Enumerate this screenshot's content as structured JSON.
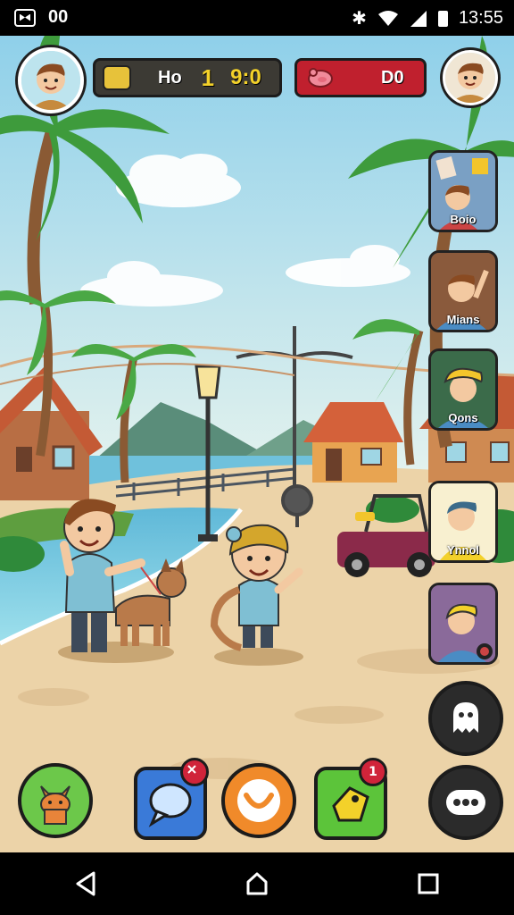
{
  "status_bar": {
    "left_text": "00",
    "time": "13:55",
    "icons": [
      "app-notification-icon",
      "bluetooth-icon",
      "wifi-icon",
      "signal-icon",
      "battery-icon"
    ]
  },
  "hud": {
    "score_label": "Ho",
    "score_value": "1",
    "timer": "9:0",
    "opponent_value": "D0"
  },
  "side_cards": [
    {
      "label": "Boio"
    },
    {
      "label": "Mians"
    },
    {
      "label": "Qons"
    },
    {
      "label": "Ynnol"
    },
    {
      "label": ""
    }
  ],
  "bottom_buttons": {
    "badge_chat": "",
    "badge_tag": "1"
  },
  "colors": {
    "sky": "#bfe6f2",
    "sand": "#ecd3a8",
    "sea": "#7fcde3",
    "hud_bg": "#3c3a34",
    "opponent_bg": "#c0202e",
    "accent_yellow": "#f3d12a"
  }
}
